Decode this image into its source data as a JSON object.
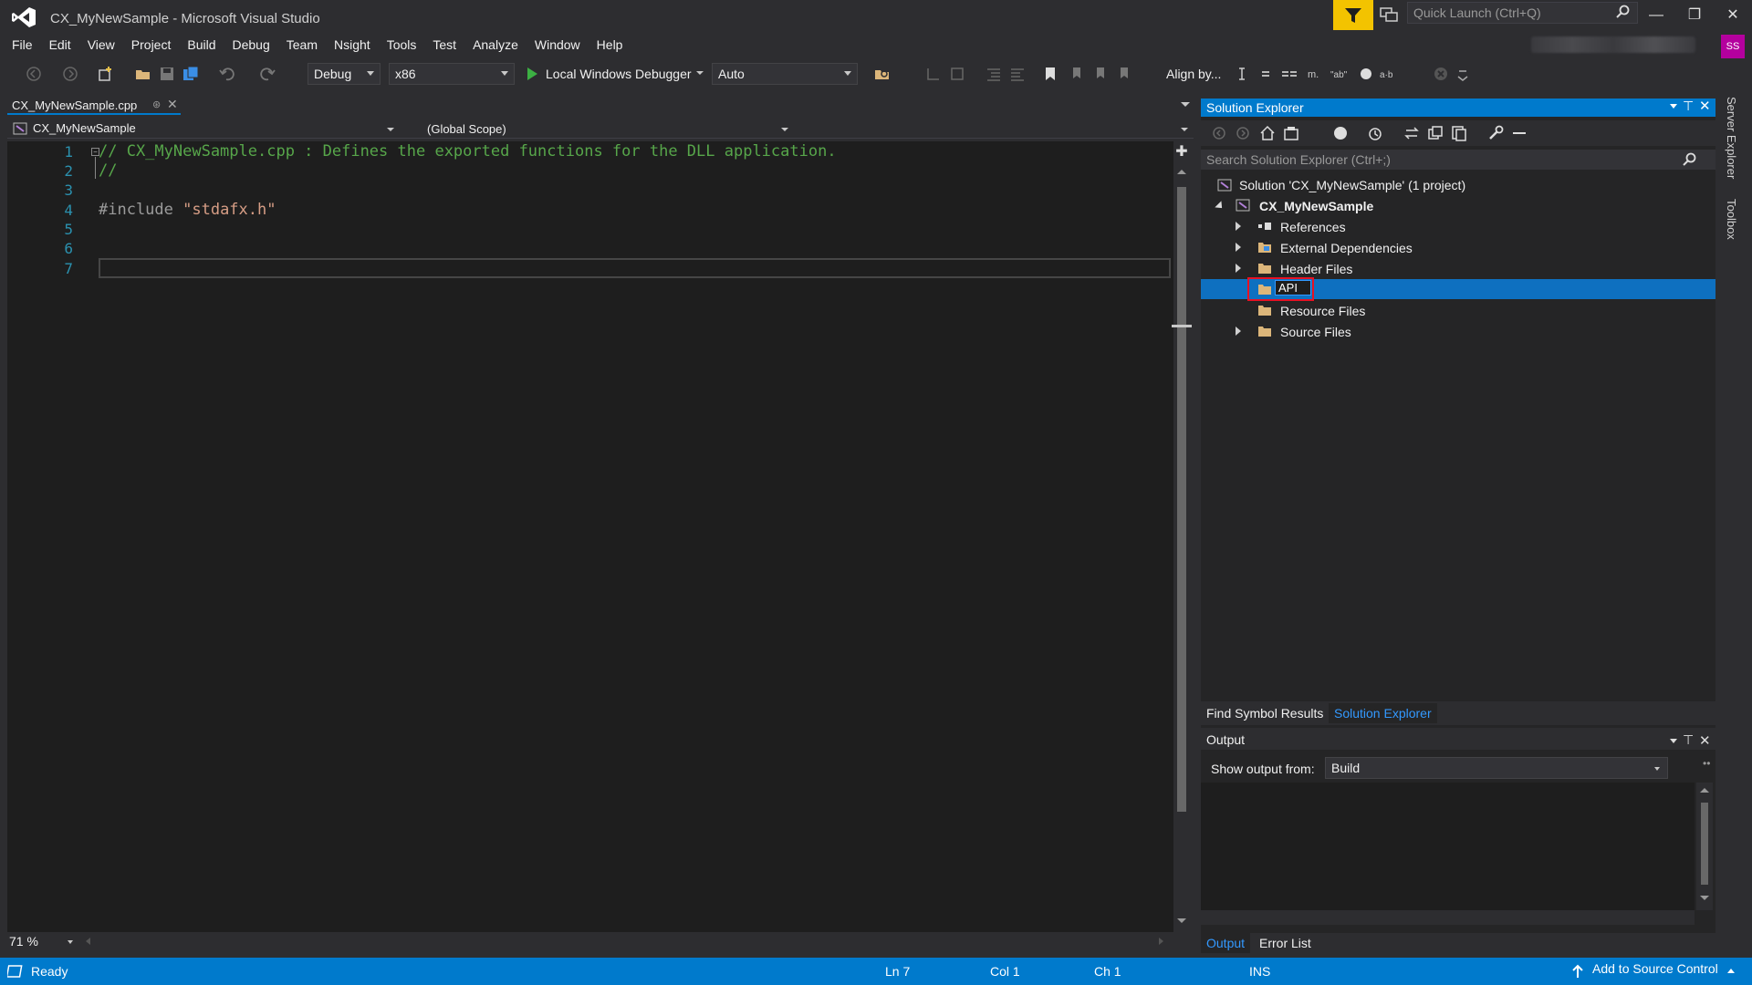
{
  "window": {
    "title": "CX_MyNewSample - Microsoft Visual Studio",
    "quick_launch_placeholder": "Quick Launch (Ctrl+Q)",
    "user_initials": "SS"
  },
  "menu": [
    "File",
    "Edit",
    "View",
    "Project",
    "Build",
    "Debug",
    "Team",
    "Nsight",
    "Tools",
    "Test",
    "Analyze",
    "Window",
    "Help"
  ],
  "toolbar": {
    "configuration": "Debug",
    "platform": "x86",
    "run_label": "Local Windows Debugger",
    "run_mode": "Auto",
    "align_label": "Align by..."
  },
  "editor": {
    "tab_name": "CX_MyNewSample.cpp",
    "nav_project": "CX_MyNewSample",
    "nav_scope": "(Global Scope)",
    "zoom": "71 %",
    "lines": [
      {
        "num": "1",
        "text": "// CX_MyNewSample.cpp : Defines the exported functions for the DLL application."
      },
      {
        "num": "2",
        "text": "//"
      },
      {
        "num": "3",
        "text": ""
      },
      {
        "num": "4",
        "text": "#include ",
        "string": "\"stdafx.h\""
      },
      {
        "num": "5",
        "text": ""
      },
      {
        "num": "6",
        "text": ""
      },
      {
        "num": "7",
        "text": ""
      }
    ]
  },
  "solution_explorer": {
    "title": "Solution Explorer",
    "search_placeholder": "Search Solution Explorer (Ctrl+;)",
    "solution": "Solution 'CX_MyNewSample' (1 project)",
    "project": "CX_MyNewSample",
    "items": [
      "References",
      "External Dependencies",
      "Header Files",
      "API",
      "Resource Files",
      "Source Files"
    ],
    "tabs": [
      "Find Symbol Results",
      "Solution Explorer"
    ]
  },
  "output": {
    "title": "Output",
    "show_from_label": "Show output from:",
    "source": "Build",
    "tabs": [
      "Output",
      "Error List"
    ]
  },
  "side_tabs": [
    "Server Explorer",
    "Toolbox"
  ],
  "status": {
    "state": "Ready",
    "ln": "Ln 7",
    "col": "Col 1",
    "ch": "Ch 1",
    "mode": "INS",
    "source_control": "Add to Source Control"
  },
  "colors": {
    "accent": "#007acc",
    "comment": "#57a64a",
    "string": "#d69d85",
    "line_number": "#2b91af",
    "filter_badge": "#f3c300"
  }
}
